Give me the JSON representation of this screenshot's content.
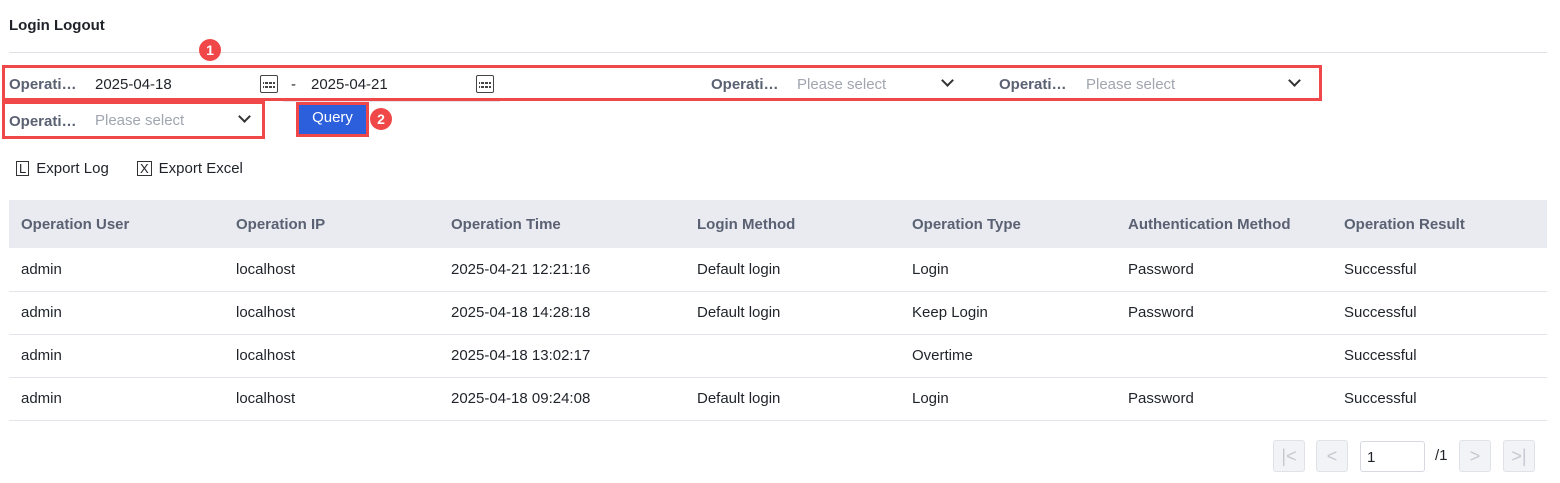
{
  "title": "Login Logout",
  "filters": {
    "time_label": "Operati…",
    "date_start": "2025-04-18",
    "date_sep": "-",
    "date_end": "2025-04-21",
    "filter2_label": "Operati…",
    "filter2_placeholder": "Please select",
    "filter3_label": "Operati…",
    "filter3_placeholder": "Please select",
    "filter4_label": "Operati…",
    "filter4_placeholder": "Please select",
    "query_label": "Query"
  },
  "annotations": [
    "1",
    "2"
  ],
  "toolbar": {
    "export_log": "Export Log",
    "export_excel": "Export Excel"
  },
  "table": {
    "headers": [
      "Operation User",
      "Operation IP",
      "Operation Time",
      "Login Method",
      "Operation Type",
      "Authentication Method",
      "Operation Result"
    ],
    "rows": [
      [
        "admin",
        "localhost",
        "2025-04-21 12:21:16",
        "Default login",
        "Login",
        "Password",
        "Successful"
      ],
      [
        "admin",
        "localhost",
        "2025-04-18 14:28:18",
        "Default login",
        "Keep Login",
        "Password",
        "Successful"
      ],
      [
        "admin",
        "localhost",
        "2025-04-18 13:02:17",
        "",
        "Overtime",
        "",
        "Successful"
      ],
      [
        "admin",
        "localhost",
        "2025-04-18 09:24:08",
        "Default login",
        "Login",
        "Password",
        "Successful"
      ]
    ]
  },
  "pagination": {
    "page": "1",
    "total": "/1"
  }
}
